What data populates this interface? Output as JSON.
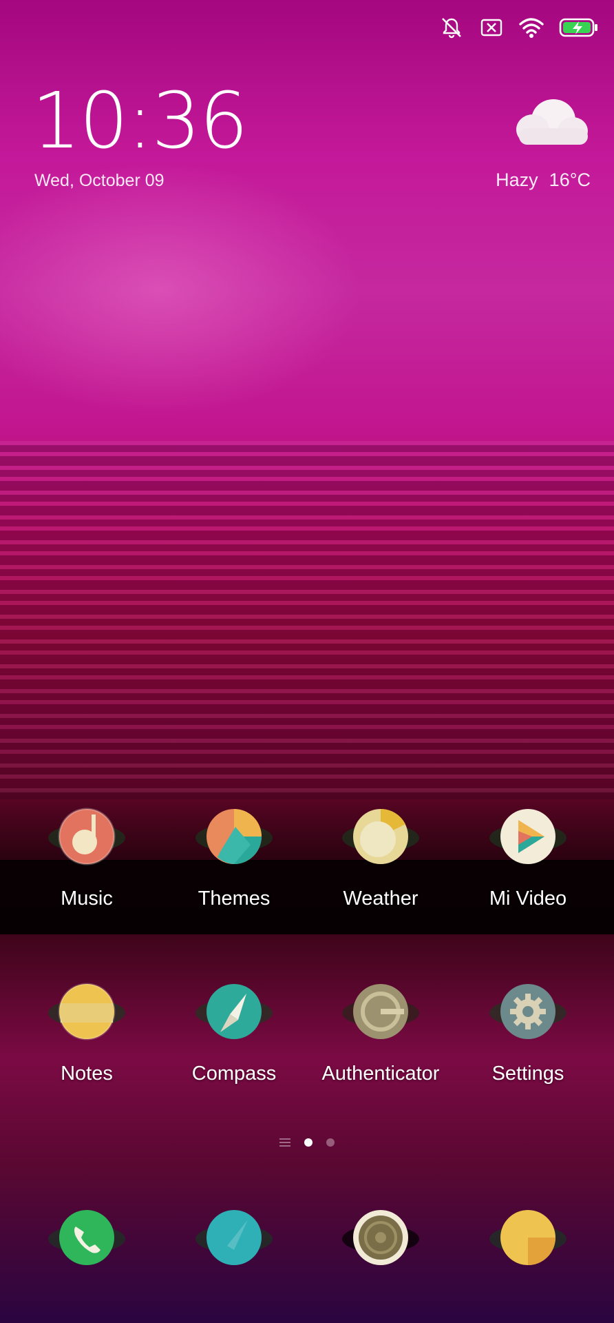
{
  "status_bar": {
    "icons": [
      "mute-icon",
      "no-sim-icon",
      "wifi-icon",
      "battery-charging-icon"
    ]
  },
  "clock": {
    "time": "10:36",
    "date": "Wed, October 09"
  },
  "weather": {
    "icon": "cloud-icon",
    "condition": "Hazy",
    "temperature": "16°C"
  },
  "apps": {
    "row1": [
      {
        "label": "Music",
        "icon": "music-icon"
      },
      {
        "label": "Themes",
        "icon": "themes-icon"
      },
      {
        "label": "Weather",
        "icon": "weather-app-icon"
      },
      {
        "label": "Mi Video",
        "icon": "mi-video-icon"
      }
    ],
    "row2": [
      {
        "label": "Notes",
        "icon": "notes-icon"
      },
      {
        "label": "Compass",
        "icon": "compass-icon"
      },
      {
        "label": "Authenticator",
        "icon": "authenticator-icon"
      },
      {
        "label": "Settings",
        "icon": "settings-icon"
      }
    ]
  },
  "page_indicator": {
    "pages": 2,
    "active": 1
  },
  "dock": [
    "phone-icon",
    "messages-icon",
    "camera-icon",
    "browser-icon"
  ],
  "colors": {
    "wallpaper_top": "#a4077f",
    "wallpaper_mid": "#96083e",
    "battery_accent": "#39d353"
  }
}
